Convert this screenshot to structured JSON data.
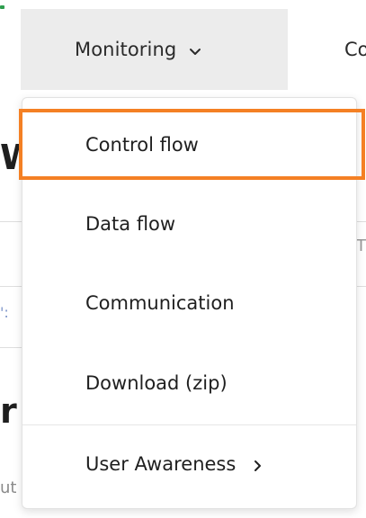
{
  "nav": {
    "active_tab_label": "Monitoring",
    "active_tab_icon": "chevron-down-icon",
    "next_tab_label": "Co"
  },
  "background": {
    "heading_fragment": "W",
    "mark_right": "T",
    "mark_left": "':",
    "big_fragment": "r",
    "small_fragment": "ut"
  },
  "dropdown": {
    "items": [
      {
        "label": "Control flow",
        "highlighted": true
      },
      {
        "label": "Data flow"
      },
      {
        "label": "Communication"
      },
      {
        "label": "Download (zip)"
      },
      {
        "label": "User Awareness",
        "has_submenu": true,
        "icon": "chevron-right-icon"
      }
    ]
  },
  "colors": {
    "highlight": "#f48024",
    "active_tab_bg": "#ececec",
    "accent_green": "#2e9e4e"
  }
}
